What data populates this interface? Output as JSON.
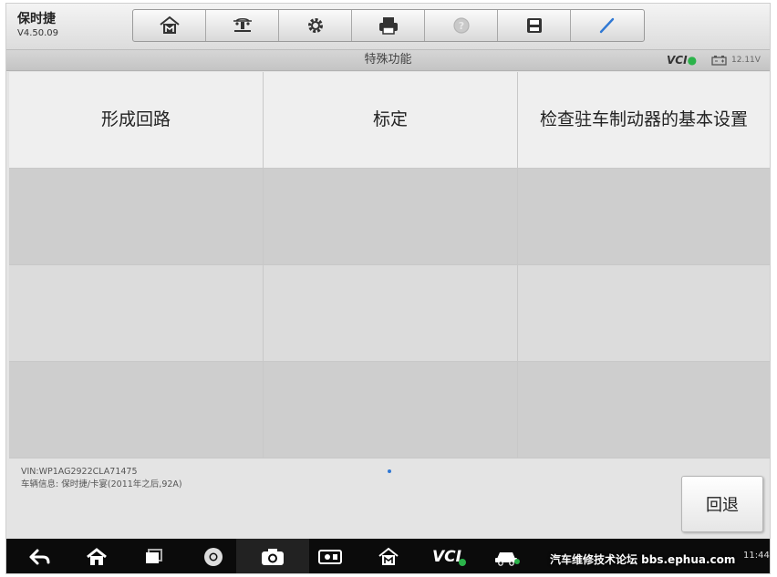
{
  "app": {
    "name": "保时捷",
    "version": "V4.50.09"
  },
  "toolbar": {
    "buttons": [
      {
        "icon": "home-m-icon"
      },
      {
        "icon": "vehicle-lift-icon"
      },
      {
        "icon": "gear-icon"
      },
      {
        "icon": "printer-icon"
      },
      {
        "icon": "help-icon"
      },
      {
        "icon": "save-icon"
      },
      {
        "icon": "pen-icon"
      }
    ]
  },
  "titlebar": {
    "title": "特殊功能",
    "vci_label": "VCI",
    "voltage": "12.11V"
  },
  "functions": [
    {
      "label": "形成回路"
    },
    {
      "label": "标定"
    },
    {
      "label": "检查驻车制动器的基本设置"
    }
  ],
  "footer": {
    "vin": "VIN:WP1AG2922CLA71475",
    "vehicle_info": "车辆信息: 保时捷/卡宴(2011年之后,92A)",
    "back_label": "回退"
  },
  "navbar": {
    "vci_label": "VCI",
    "clock": "11:44",
    "watermark": "汽车维修技术论坛 bbs.ephua.com"
  },
  "colors": {
    "accent_blue": "#2f78d4",
    "vci_green": "#2bb34a"
  }
}
